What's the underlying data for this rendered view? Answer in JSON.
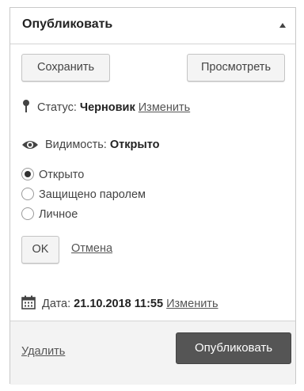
{
  "panel": {
    "title": "Опубликовать"
  },
  "buttons": {
    "save": "Сохранить",
    "preview": "Просмотреть",
    "ok": "OK",
    "publish": "Опубликовать"
  },
  "status": {
    "label": "Статус:",
    "value": "Черновик",
    "edit_link": "Изменить",
    "icon": "pin-icon"
  },
  "visibility": {
    "label": "Видимость:",
    "value": "Открыто",
    "icon": "eye-icon",
    "options": [
      "Открыто",
      "Защищено паролем",
      "Личное"
    ],
    "selected": 0
  },
  "cancel_link": "Отмена",
  "date": {
    "label": "Дата:",
    "value": "21.10.2018 11:55",
    "edit_link": "Изменить",
    "icon": "calendar-icon"
  },
  "footer": {
    "delete_link": "Удалить"
  }
}
